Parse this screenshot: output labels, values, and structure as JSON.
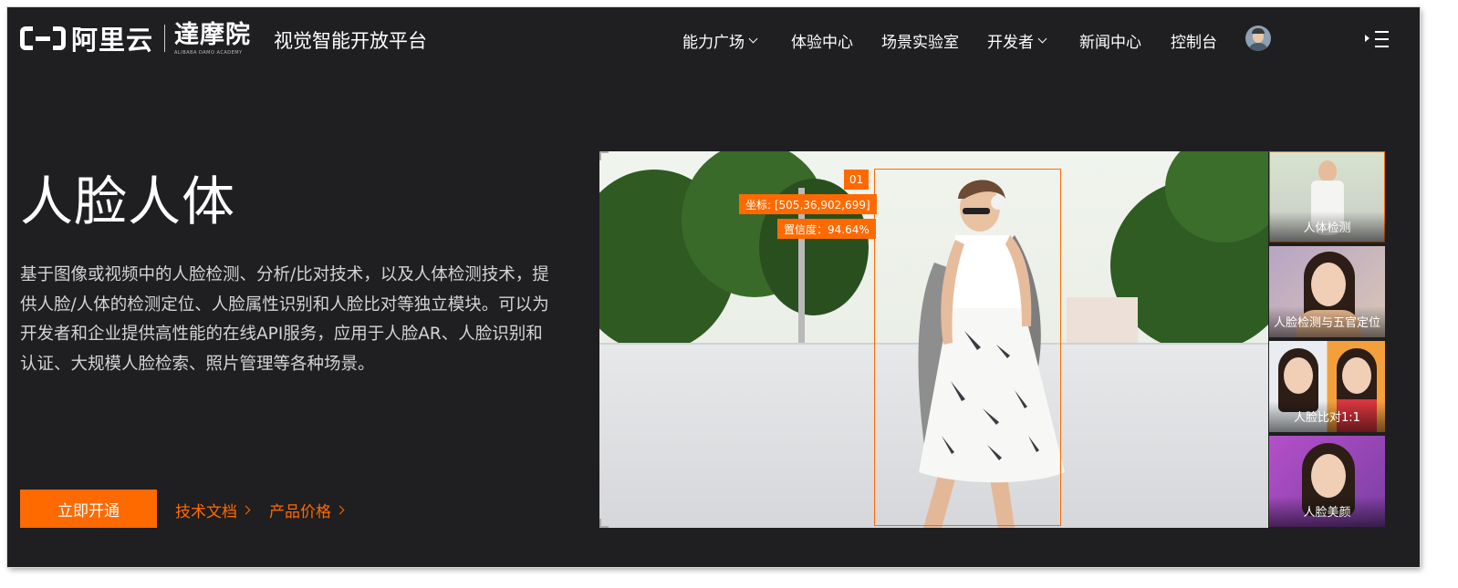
{
  "header": {
    "logo_text": "阿里云",
    "damo_cn": "達摩院",
    "damo_en": "ALIBABA DAMO ACADEMY",
    "platform_title": "视觉智能开放平台",
    "nav": [
      {
        "label": "能力广场",
        "dropdown": true
      },
      {
        "label": "体验中心",
        "dropdown": false
      },
      {
        "label": "场景实验室",
        "dropdown": false
      },
      {
        "label": "开发者",
        "dropdown": true
      },
      {
        "label": "新闻中心",
        "dropdown": false
      },
      {
        "label": "控制台",
        "dropdown": false
      }
    ]
  },
  "hero": {
    "title": "人脸人体",
    "description": "基于图像或视频中的人脸检测、分析/比对技术，以及人体检测技术，提供人脸/人体的检测定位、人脸属性识别和人脸比对等独立模块。可以为开发者和企业提供高性能的在线API服务，应用于人脸AR、人脸识别和认证、大规模人脸检索、照片管理等各种场景。",
    "primary_button": "立即开通",
    "links": [
      "技术文档",
      "产品价格"
    ]
  },
  "demo": {
    "detection_id": "01",
    "coordinates": "坐标: [505,36,902,699]",
    "confidence": "置信度：94.64%",
    "thumbnails": [
      {
        "label": "人体检测",
        "active": true
      },
      {
        "label": "人脸检测与五官定位",
        "active": false
      },
      {
        "label": "人脸比对1:1",
        "active": false
      },
      {
        "label": "人脸美颜",
        "active": false
      }
    ]
  },
  "colors": {
    "accent": "#ff6a00",
    "background": "#1f1e21"
  },
  "icons": [
    "chevron-down-icon",
    "chevron-right-icon",
    "menu-icon",
    "user-avatar"
  ]
}
